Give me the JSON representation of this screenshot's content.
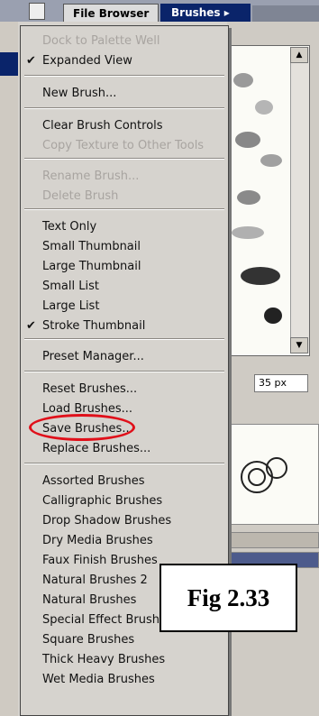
{
  "tabs": {
    "file_browser": "File Browser",
    "brushes": "Brushes ▸"
  },
  "brush_size": "35 px",
  "menu": {
    "items": [
      {
        "label": "Dock to Palette Well",
        "disabled": true,
        "checked": false
      },
      {
        "label": "Expanded View",
        "disabled": false,
        "checked": true
      },
      {
        "label": "New Brush...",
        "disabled": false,
        "checked": false
      },
      {
        "label": "Clear Brush Controls",
        "disabled": false,
        "checked": false
      },
      {
        "label": "Copy Texture to Other Tools",
        "disabled": true,
        "checked": false
      },
      {
        "label": "Rename Brush...",
        "disabled": true,
        "checked": false
      },
      {
        "label": "Delete Brush",
        "disabled": true,
        "checked": false
      },
      {
        "label": "Text Only",
        "disabled": false,
        "checked": false
      },
      {
        "label": "Small Thumbnail",
        "disabled": false,
        "checked": false
      },
      {
        "label": "Large Thumbnail",
        "disabled": false,
        "checked": false
      },
      {
        "label": "Small List",
        "disabled": false,
        "checked": false
      },
      {
        "label": "Large List",
        "disabled": false,
        "checked": false
      },
      {
        "label": "Stroke Thumbnail",
        "disabled": false,
        "checked": true
      },
      {
        "label": "Preset Manager...",
        "disabled": false,
        "checked": false
      },
      {
        "label": "Reset Brushes...",
        "disabled": false,
        "checked": false
      },
      {
        "label": "Load Brushes...",
        "disabled": false,
        "checked": false,
        "highlighted": true
      },
      {
        "label": "Save Brushes...",
        "disabled": false,
        "checked": false
      },
      {
        "label": "Replace Brushes...",
        "disabled": false,
        "checked": false
      },
      {
        "label": "Assorted Brushes",
        "disabled": false,
        "checked": false
      },
      {
        "label": "Calligraphic Brushes",
        "disabled": false,
        "checked": false
      },
      {
        "label": "Drop Shadow Brushes",
        "disabled": false,
        "checked": false
      },
      {
        "label": "Dry Media Brushes",
        "disabled": false,
        "checked": false
      },
      {
        "label": "Faux Finish Brushes",
        "disabled": false,
        "checked": false
      },
      {
        "label": "Natural Brushes 2",
        "disabled": false,
        "checked": false
      },
      {
        "label": "Natural Brushes",
        "disabled": false,
        "checked": false
      },
      {
        "label": "Special Effect Brushes",
        "disabled": false,
        "checked": false
      },
      {
        "label": "Square Brushes",
        "disabled": false,
        "checked": false
      },
      {
        "label": "Thick Heavy Brushes",
        "disabled": false,
        "checked": false
      },
      {
        "label": "Wet Media Brushes",
        "disabled": false,
        "checked": false
      }
    ],
    "check_glyph": "✔"
  },
  "figure_caption": "Fig 2.33",
  "colors": {
    "highlight_oval": "#e0101a",
    "active_tab": "#0a246a",
    "disabled_text": "#a8a4a0"
  }
}
